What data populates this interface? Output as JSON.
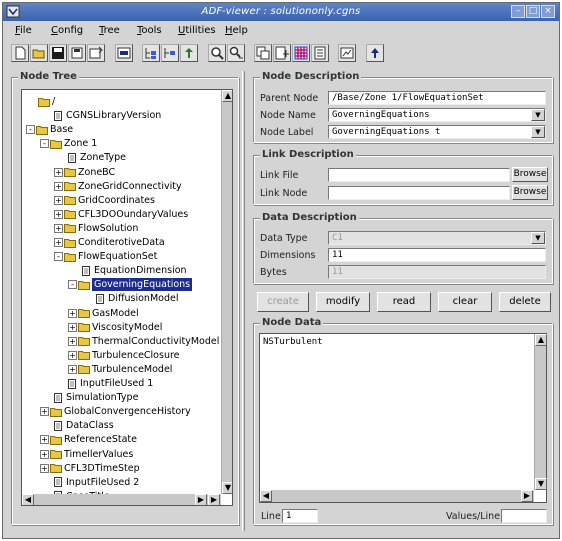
{
  "window": {
    "title": "ADF-viewer : solutiononly.cgns"
  },
  "titlebar_buttons": [
    "minimize-button",
    "maximize-button",
    "close-button"
  ],
  "menubar": [
    {
      "label": "File",
      "key": "F"
    },
    {
      "label": "Config",
      "key": "C"
    },
    {
      "label": "Tree",
      "key": "T"
    },
    {
      "label": "Tools",
      "key": "T"
    },
    {
      "label": "Utilities",
      "key": "U"
    },
    {
      "label": "Help",
      "key": "H"
    }
  ],
  "toolbar_icons": [
    "new-file-icon",
    "open-folder-icon",
    "save-icon",
    "save-as-icon",
    "file-info-icon",
    "print-icon",
    "expand-tree-icon",
    "collapse-tree-icon",
    "tree-up-icon",
    "find-icon",
    "find-next-icon",
    "copy-node-icon",
    "paste-node-icon",
    "link-icon",
    "config-icon",
    "plot-icon",
    "help-icon"
  ],
  "node_tree": {
    "legend": "Node Tree",
    "items": [
      {
        "depth": 0,
        "label": "/",
        "type": "folder",
        "expander": ""
      },
      {
        "depth": 1,
        "label": "CGNSLibraryVersion",
        "type": "file",
        "expander": ""
      },
      {
        "depth": 0,
        "label": "Base",
        "type": "folder",
        "expander": "-"
      },
      {
        "depth": 1,
        "label": "Zone    1",
        "type": "folder",
        "expander": "-"
      },
      {
        "depth": 2,
        "label": "ZoneType",
        "type": "file",
        "expander": ""
      },
      {
        "depth": 2,
        "label": "ZoneBC",
        "type": "folder",
        "expander": "+"
      },
      {
        "depth": 2,
        "label": "ZoneGridConnectivity",
        "type": "folder",
        "expander": "+"
      },
      {
        "depth": 2,
        "label": "GridCoordinates",
        "type": "folder",
        "expander": "+"
      },
      {
        "depth": 2,
        "label": "CFL3DOOundaryValues",
        "type": "folder",
        "expander": "+"
      },
      {
        "depth": 2,
        "label": "FlowSolution",
        "type": "folder",
        "expander": "+"
      },
      {
        "depth": 2,
        "label": "ConditerotiveData",
        "type": "folder",
        "expander": "+"
      },
      {
        "depth": 2,
        "label": "FlowEquationSet",
        "type": "folder",
        "expander": "-"
      },
      {
        "depth": 3,
        "label": "EquationDimension",
        "type": "file",
        "expander": ""
      },
      {
        "depth": 3,
        "label": "GoverningEquations",
        "type": "folder",
        "expander": "-",
        "selected": true
      },
      {
        "depth": 4,
        "label": "DiffusionModel",
        "type": "file",
        "expander": ""
      },
      {
        "depth": 3,
        "label": "GasModel",
        "type": "folder",
        "expander": "+"
      },
      {
        "depth": 3,
        "label": "ViscosityModel",
        "type": "folder",
        "expander": "+"
      },
      {
        "depth": 3,
        "label": "ThermalConductivityModel",
        "type": "folder",
        "expander": "+"
      },
      {
        "depth": 3,
        "label": "TurbulenceClosure",
        "type": "folder",
        "expander": "+"
      },
      {
        "depth": 3,
        "label": "TurbulenceModel",
        "type": "folder",
        "expander": "+"
      },
      {
        "depth": 2,
        "label": "InputFileUsed 1",
        "type": "file",
        "expander": ""
      },
      {
        "depth": 1,
        "label": "SimulationType",
        "type": "file",
        "expander": ""
      },
      {
        "depth": 1,
        "label": "GlobalConvergenceHistory",
        "type": "folder",
        "expander": "+"
      },
      {
        "depth": 1,
        "label": "DataClass",
        "type": "file",
        "expander": ""
      },
      {
        "depth": 1,
        "label": "ReferenceState",
        "type": "folder",
        "expander": "+"
      },
      {
        "depth": 1,
        "label": "TimellerValues",
        "type": "folder",
        "expander": "+"
      },
      {
        "depth": 1,
        "label": "CFL3DTimeStep",
        "type": "folder",
        "expander": "+"
      },
      {
        "depth": 1,
        "label": "InputFileUsed 2",
        "type": "file",
        "expander": ""
      },
      {
        "depth": 1,
        "label": "CaseTitle",
        "type": "file",
        "expander": ""
      }
    ]
  },
  "node_description": {
    "legend": "Node Description",
    "parent_node_label": "Parent Node",
    "parent_node_value": "/Base/Zone    1/FlowEquationSet",
    "node_name_label": "Node Name",
    "node_name_value": "GoverningEquations",
    "node_label_label": "Node Label",
    "node_label_value": "GoverningEquations t"
  },
  "link_description": {
    "legend": "Link Description",
    "link_file_label": "Link File",
    "link_file_value": "",
    "link_node_label": "Link Node",
    "link_node_value": "",
    "browse_label": "Browse"
  },
  "data_description": {
    "legend": "Data Description",
    "data_type_label": "Data Type",
    "data_type_value": "C1",
    "dimensions_label": "Dimensions",
    "dimensions_value": "11",
    "bytes_label": "Bytes",
    "bytes_value": "11"
  },
  "actions": {
    "create": "create",
    "modify": "modify",
    "read": "read",
    "clear": "clear",
    "delete": "delete"
  },
  "node_data": {
    "legend": "Node Data",
    "text": "NSTurbulent",
    "line_label": "Line",
    "line_value": "1",
    "values_per_line_label": "Values/Line",
    "values_per_line_value": ""
  }
}
